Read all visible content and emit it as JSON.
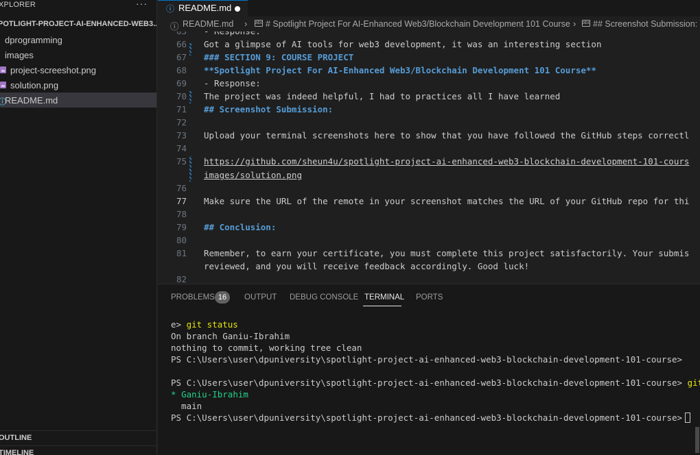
{
  "sidebar": {
    "title": "XPLORER",
    "more_label": "···",
    "project_folder": "POTLIGHT-PROJECT-AI-ENHANCED-WEB3...",
    "tree": [
      {
        "label": "dprogramming",
        "kind": "folder"
      },
      {
        "label": "images",
        "kind": "folder"
      },
      {
        "label": "project-screeshot.png",
        "kind": "image"
      },
      {
        "label": "solution.png",
        "kind": "image"
      },
      {
        "label": "README.md",
        "kind": "markdown",
        "selected": true
      }
    ],
    "sections": [
      "OUTLINE",
      "TIMELINE"
    ]
  },
  "tab": {
    "icon": "info-icon",
    "label": "README.md",
    "dirty": true
  },
  "breadcrumbs": {
    "file": "README.md",
    "section1": "# Spotlight Project For AI-Enhanced Web3/Blockchain Development 101 Course",
    "section2": "## Screenshot Submission:",
    "icon": "symbol-string-icon",
    "icon_glyph": "abc",
    "separator": "›"
  },
  "editor": {
    "lines": [
      {
        "num": "65",
        "text": "- Response:",
        "style": "plain"
      },
      {
        "num": "66",
        "text": "Got a glimpse of AI tools for web3 development, it was an interesting section",
        "style": "plain"
      },
      {
        "num": "67",
        "text": "### SECTION 9: COURSE PROJECT",
        "style": "head"
      },
      {
        "num": "68",
        "text": "**Spotlight Project For AI-Enhanced Web3/Blockchain Development 101 Course**",
        "style": "bold"
      },
      {
        "num": "69",
        "text": "- Response:",
        "style": "plain"
      },
      {
        "num": "70",
        "text": "The project was indeed helpful, I had to practices all I have learned",
        "style": "plain"
      },
      {
        "num": "71",
        "text": "## Screenshot Submission:",
        "style": "head"
      },
      {
        "num": "72",
        "text": "",
        "style": "plain"
      },
      {
        "num": "73",
        "text": "Upload your terminal screenshots here to show that you have followed the GitHub steps correctl",
        "style": "plain"
      },
      {
        "num": "74",
        "text": "",
        "style": "plain"
      },
      {
        "num": "75",
        "text": "https://github.com/sheun4u/spotlight-project-ai-enhanced-web3-blockchain-development-101-cours",
        "style": "link"
      },
      {
        "num": "",
        "text": "images/solution.png",
        "style": "link"
      },
      {
        "num": "76",
        "text": "",
        "style": "plain"
      },
      {
        "num": "77",
        "text": "Make sure the URL of the remote in your screenshot matches the URL of your GitHub repo for thi",
        "style": "plain"
      },
      {
        "num": "78",
        "text": "",
        "style": "plain"
      },
      {
        "num": "79",
        "text": "## Conclusion:",
        "style": "head"
      },
      {
        "num": "80",
        "text": "",
        "style": "plain"
      },
      {
        "num": "81",
        "text": "Remember, to earn your certificate, you must complete this project satisfactorily. Your submis",
        "style": "plain"
      },
      {
        "num": "",
        "text": "reviewed, and you will receive feedback accordingly. Good luck!",
        "style": "plain"
      },
      {
        "num": "82",
        "text": "",
        "style": "plain"
      }
    ],
    "active_line": "77"
  },
  "panel": {
    "tabs": [
      {
        "label": "PROBLEMS",
        "active": false
      },
      {
        "label": "OUTPUT",
        "active": false
      },
      {
        "label": "DEBUG CONSOLE",
        "active": false
      },
      {
        "label": "TERMINAL",
        "active": true
      },
      {
        "label": "PORTS",
        "active": false
      }
    ],
    "problems_count": "16",
    "terminal": {
      "line1_prefix": "e> ",
      "line1_cmd": "git status",
      "line2": "On branch Ganiu-Ibrahim",
      "line3": "nothing to commit, working tree clean",
      "prompt": "PS C:\\Users\\user\\dpuniversity\\spotlight-project-ai-enhanced-web3-blockchain-development-101-course>",
      "cmd2": "git branc",
      "branch_current_marker": "* ",
      "branch_current": "Ganiu-Ibrahim",
      "branch_other": "  main"
    }
  },
  "colors": {
    "accent": "#0078d4",
    "heading": "#569cd6",
    "terminal_command": "#e5e510",
    "terminal_branch": "#23d18b"
  }
}
